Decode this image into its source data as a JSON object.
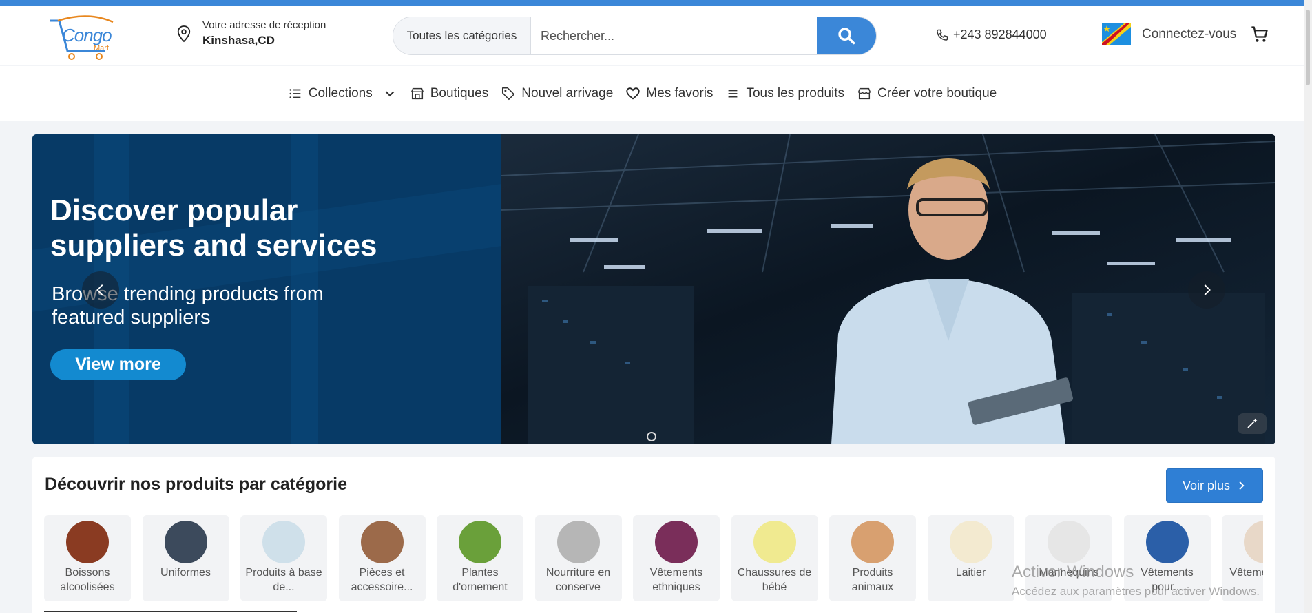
{
  "header": {
    "logo_text": "Congo",
    "logo_sub": "Mart",
    "address_label": "Votre adresse de réception",
    "address_value": "Kinshasa,CD",
    "search_category": "Toutes les catégories",
    "search_placeholder": "Rechercher...",
    "phone": "+243 892844000",
    "login_label": "Connectez-vous"
  },
  "nav": {
    "collections": "Collections",
    "boutiques": "Boutiques",
    "nouvel_arrivage": "Nouvel arrivage",
    "mes_favoris": "Mes favoris",
    "tous_les_produits": "Tous les produits",
    "creer_boutique": "Créer votre boutique"
  },
  "hero": {
    "title": "Discover popular suppliers and services",
    "subtitle": "Browse trending products from featured suppliers",
    "cta": "View more"
  },
  "categories": {
    "heading": "Découvrir nos produits par catégorie",
    "voir_plus": "Voir plus",
    "items": [
      {
        "label": "Boissons alcoolisées",
        "color": "#8a3b22"
      },
      {
        "label": "Uniformes",
        "color": "#3c4a5c"
      },
      {
        "label": "Produits à base de...",
        "color": "#cfe0ea"
      },
      {
        "label": "Pièces et accessoire...",
        "color": "#9c6a4a"
      },
      {
        "label": "Plantes d'ornement",
        "color": "#6aa03a"
      },
      {
        "label": "Nourriture en conserve",
        "color": "#b6b6b6"
      },
      {
        "label": "Vêtements ethniques",
        "color": "#7a2e5a"
      },
      {
        "label": "Chaussures de bébé",
        "color": "#f0ea90"
      },
      {
        "label": "Produits animaux",
        "color": "#d8a070"
      },
      {
        "label": "Laitier",
        "color": "#f3ead0"
      },
      {
        "label": "Mannequins",
        "color": "#e6e6e6"
      },
      {
        "label": "Vêtements pour...",
        "color": "#2b5fa8"
      },
      {
        "label": "Vêtements e...",
        "color": "#e8d8c8"
      }
    ]
  },
  "watermark": {
    "line1": "Activer Windows",
    "line2": "Accédez aux paramètres pour activer Windows."
  },
  "colors": {
    "brand_blue": "#3b87d8",
    "cta_blue": "#138ad0",
    "hero_navy": "#073a66"
  }
}
